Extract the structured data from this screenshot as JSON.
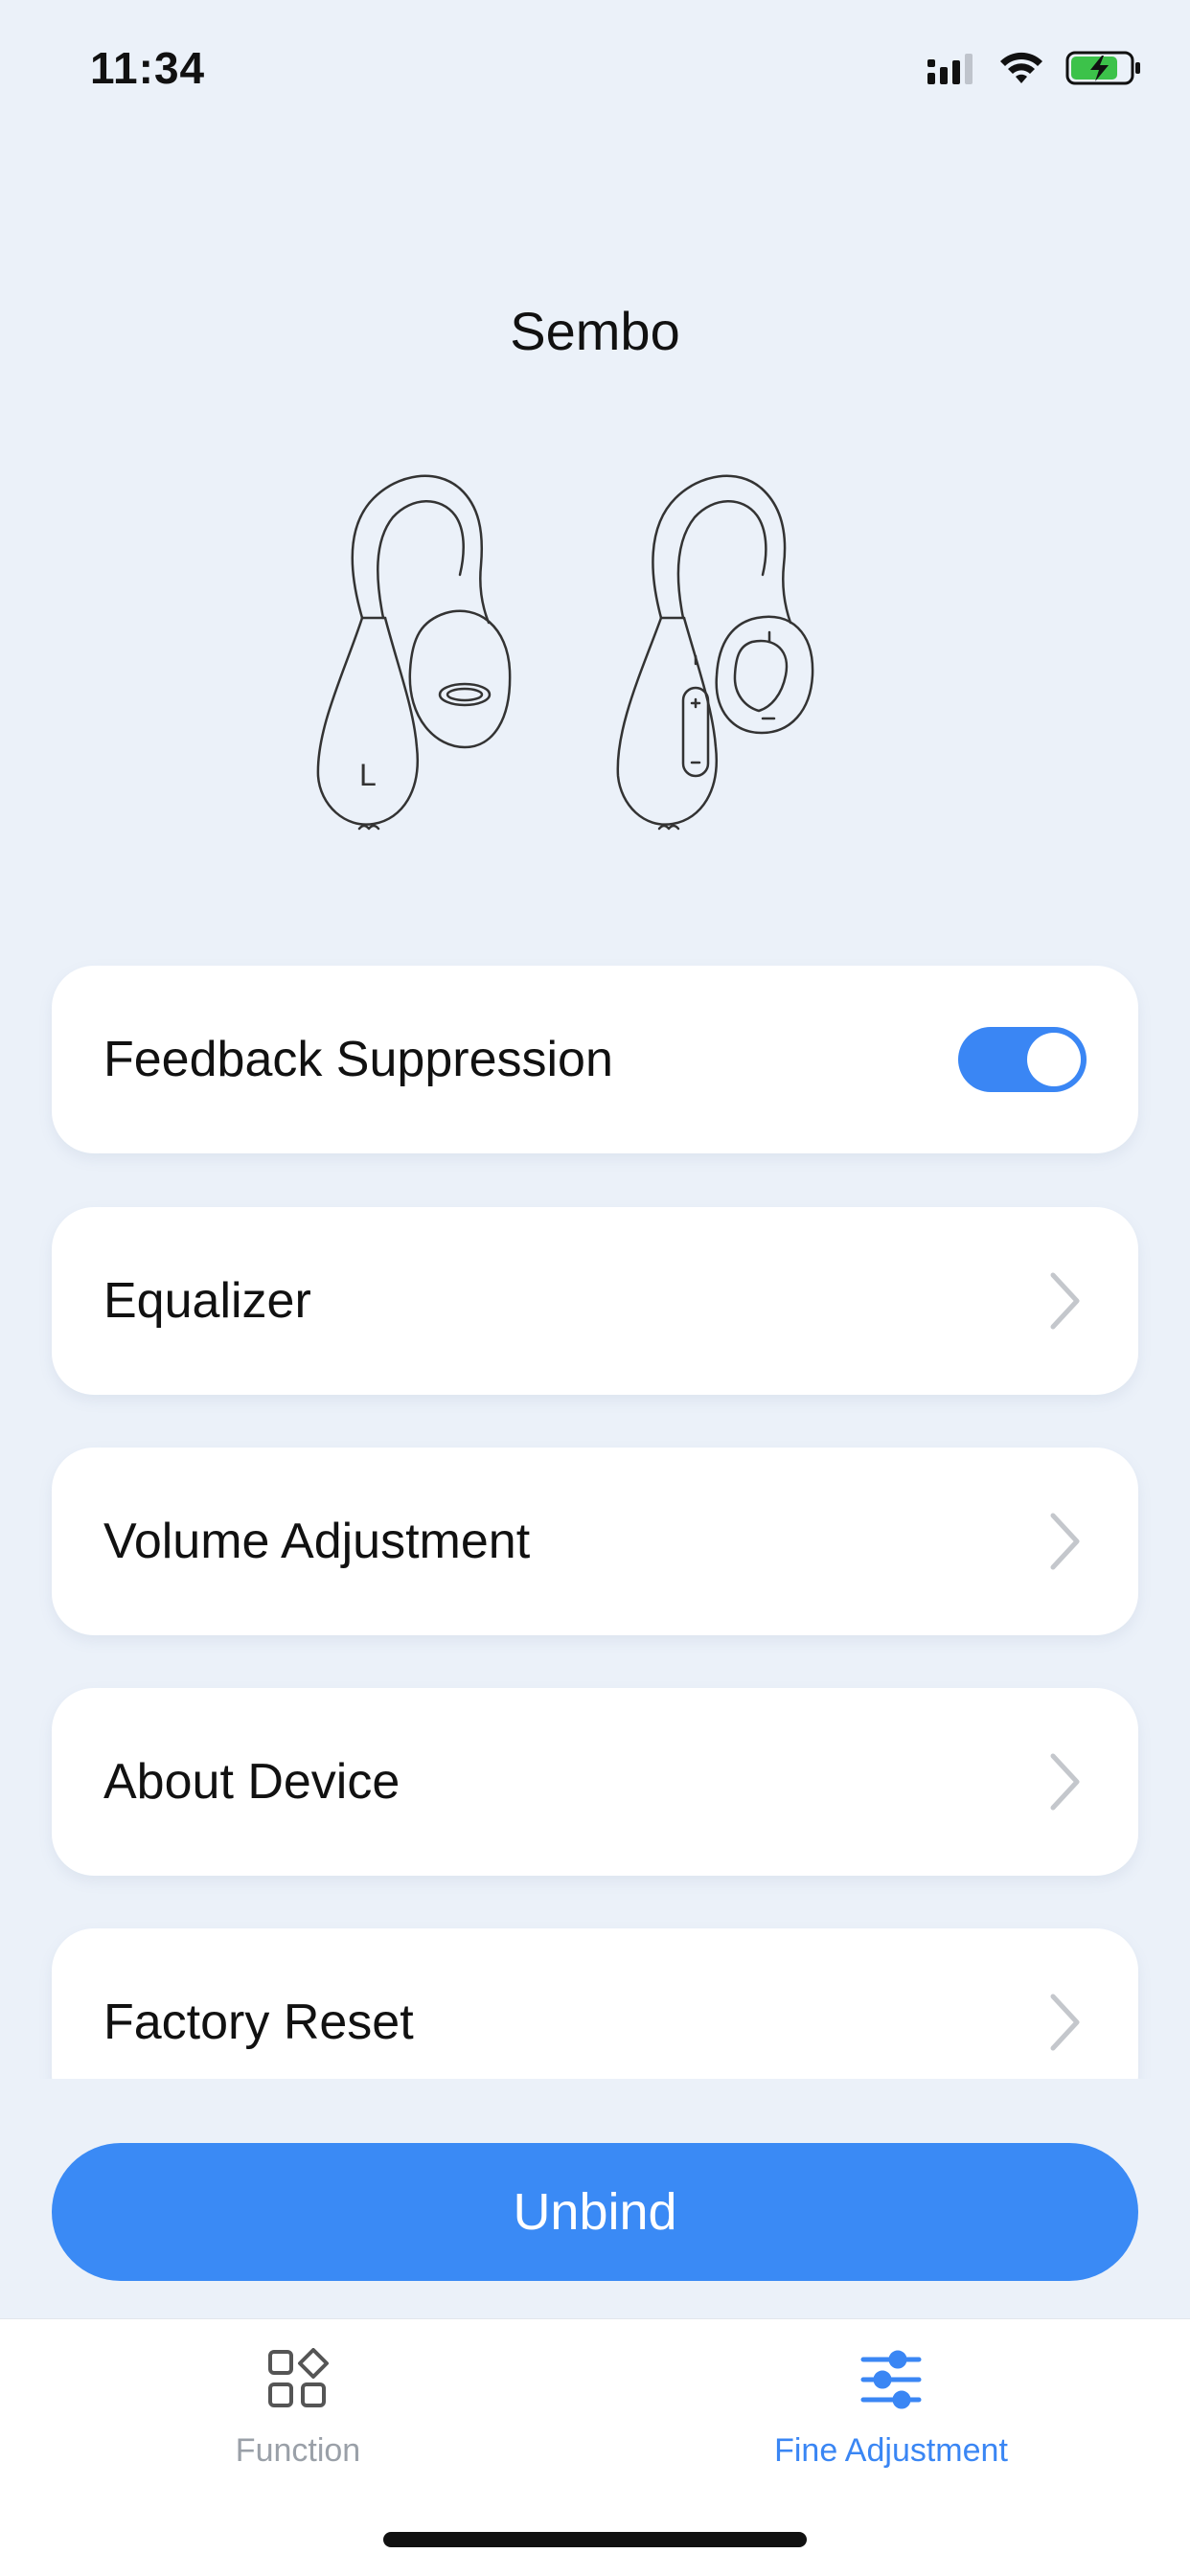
{
  "status_bar": {
    "time": "11:34"
  },
  "header": {
    "title": "Sembo"
  },
  "device": {
    "left_marker": "L"
  },
  "menu": {
    "items": [
      {
        "label": "Feedback Suppression",
        "control": "toggle",
        "toggle_on": true
      },
      {
        "label": "Equalizer",
        "control": "chevron"
      },
      {
        "label": "Volume Adjustment",
        "control": "chevron"
      },
      {
        "label": "About Device",
        "control": "chevron"
      },
      {
        "label": "Factory Reset",
        "control": "chevron"
      }
    ]
  },
  "unbind_button": {
    "label": "Unbind"
  },
  "tab_bar": {
    "tabs": [
      {
        "label": "Function",
        "icon": "grid-icon",
        "active": false
      },
      {
        "label": "Fine Adjustment",
        "icon": "sliders-icon",
        "active": true
      }
    ]
  },
  "colors": {
    "accent": "#3a86f4",
    "background": "#ebf1f9",
    "inactive_tab": "#9aa0a8"
  }
}
